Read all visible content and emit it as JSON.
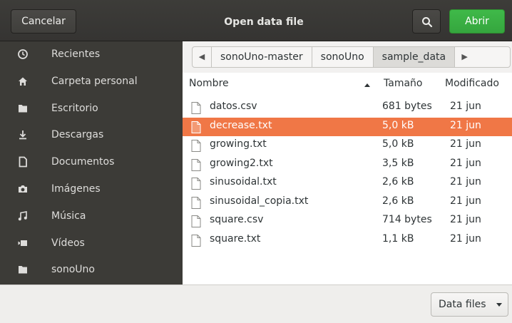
{
  "header": {
    "cancel_label": "Cancelar",
    "title": "Open data file",
    "open_label": "Abrir"
  },
  "sidebar": {
    "items": [
      {
        "label": "Recientes",
        "icon": "clock-icon"
      },
      {
        "label": "Carpeta personal",
        "icon": "home-icon"
      },
      {
        "label": "Escritorio",
        "icon": "folder-icon"
      },
      {
        "label": "Descargas",
        "icon": "download-icon"
      },
      {
        "label": "Documentos",
        "icon": "document-icon"
      },
      {
        "label": "Imágenes",
        "icon": "camera-icon"
      },
      {
        "label": "Música",
        "icon": "music-icon"
      },
      {
        "label": "Vídeos",
        "icon": "video-icon"
      },
      {
        "label": "sonoUno",
        "icon": "folder-icon"
      }
    ]
  },
  "pathbar": {
    "crumbs": [
      "sonoUno-master",
      "sonoUno",
      "sample_data"
    ]
  },
  "columns": {
    "name": "Nombre",
    "size": "Tamaño",
    "modified": "Modificado"
  },
  "files": [
    {
      "name": "datos.csv",
      "size": "681 bytes",
      "date": "21 jun"
    },
    {
      "name": "decrease.txt",
      "size": "5,0 kB",
      "date": "21 jun",
      "selected": true
    },
    {
      "name": "growing.txt",
      "size": "5,0 kB",
      "date": "21 jun"
    },
    {
      "name": "growing2.txt",
      "size": "3,5 kB",
      "date": "21 jun"
    },
    {
      "name": "sinusoidal.txt",
      "size": "2,6 kB",
      "date": "21 jun"
    },
    {
      "name": "sinusoidal_copia.txt",
      "size": "2,6 kB",
      "date": "21 jun"
    },
    {
      "name": "square.csv",
      "size": "714 bytes",
      "date": "21 jun"
    },
    {
      "name": "square.txt",
      "size": "1,1 kB",
      "date": "21 jun"
    }
  ],
  "footer": {
    "filter_label": "Data files"
  },
  "colors": {
    "accent_open": "#3fb949",
    "selection": "#f07746",
    "sidebar_bg": "#3c3b37"
  }
}
